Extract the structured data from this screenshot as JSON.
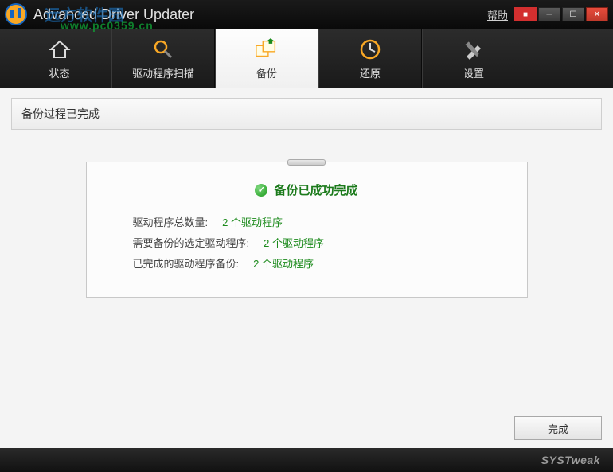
{
  "titlebar": {
    "app_title": "Advanced Driver Updater",
    "help_link": "帮助",
    "watermark_url": "www.pc0359.cn",
    "watermark_cn": "远方软件园"
  },
  "tabs": [
    {
      "id": "status",
      "label": "状态"
    },
    {
      "id": "scan",
      "label": "驱动程序扫描"
    },
    {
      "id": "backup",
      "label": "备份"
    },
    {
      "id": "restore",
      "label": "还原"
    },
    {
      "id": "settings",
      "label": "设置"
    }
  ],
  "status_text": "备份过程已完成",
  "panel": {
    "title": "备份已成功完成",
    "rows": [
      {
        "label": "驱动程序总数量:",
        "value": "2 个驱动程序"
      },
      {
        "label": "需要备份的选定驱动程序:",
        "value": "2 个驱动程序"
      },
      {
        "label": "已完成的驱动程序备份:",
        "value": "2 个驱动程序"
      }
    ]
  },
  "done_button": "完成",
  "brand": "SYSTweak"
}
